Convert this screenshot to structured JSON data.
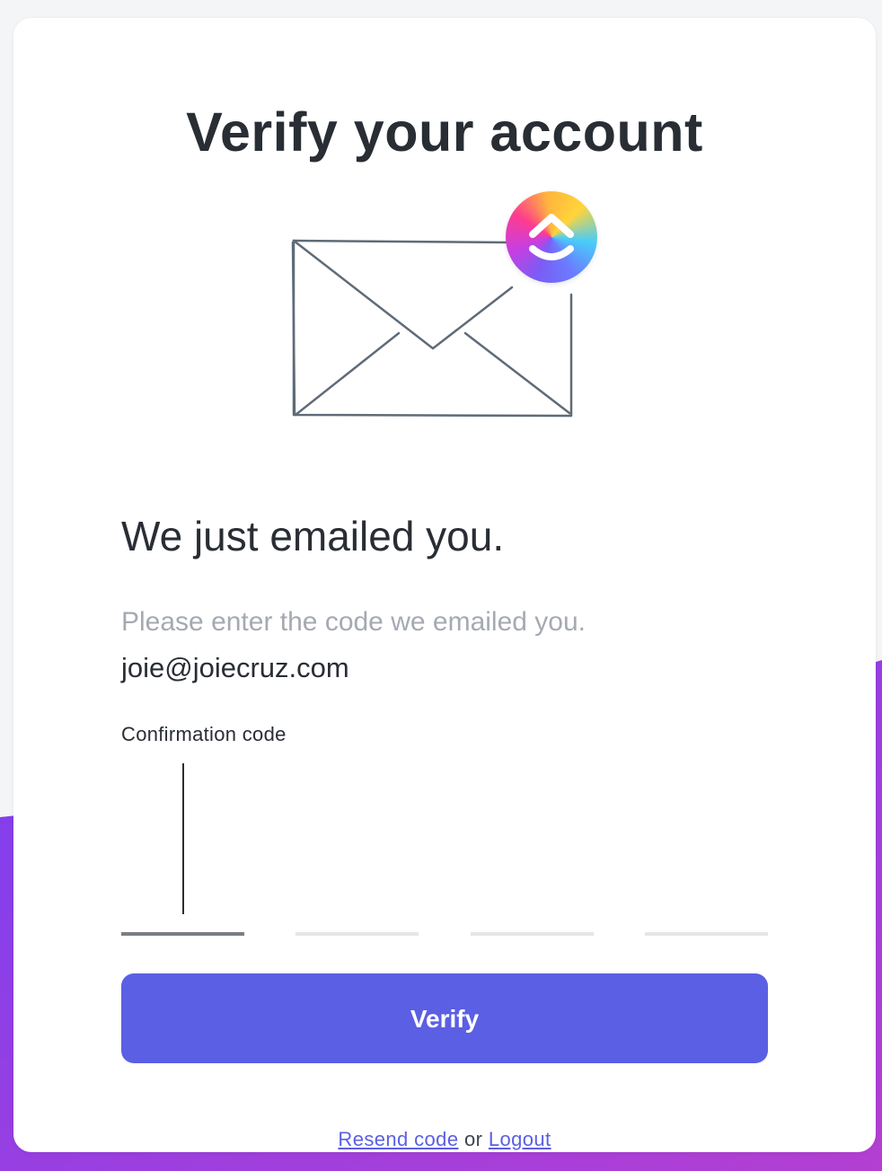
{
  "card": {
    "title": "Verify your account",
    "headline": "We just emailed you.",
    "instruction": "Please enter the code we emailed you.",
    "email": "joie@joiecruz.com",
    "code_label": "Confirmation code",
    "code_slots": [
      "",
      "",
      "",
      ""
    ],
    "verify_label": "Verify",
    "resend_label": "Resend code",
    "or_text": "or",
    "logout_label": "Logout"
  },
  "icons": {
    "illustration": "envelope-icon",
    "brand": "clickup-logo-icon"
  },
  "colors": {
    "primary": "#5b5fe3",
    "text": "#292d34",
    "muted": "#a5a9b2",
    "background_wave": "#8b3fe0"
  }
}
